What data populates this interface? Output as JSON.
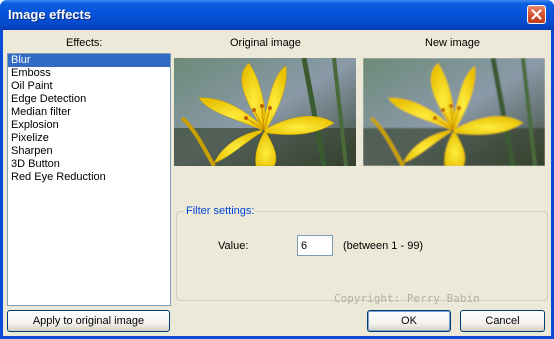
{
  "window": {
    "title": "Image effects",
    "close_icon": "close-icon"
  },
  "effects": {
    "label": "Effects:",
    "items": [
      "Blur",
      "Emboss",
      "Oil Paint",
      "Edge Detection",
      "Median filter",
      "Explosion",
      "Pixelize",
      "Sharpen",
      "3D Button",
      "Red Eye Reduction"
    ],
    "selected_index": 0
  },
  "images": {
    "original_label": "Original image",
    "new_label": "New image"
  },
  "filter": {
    "group_title": "Filter settings:",
    "value_label": "Value:",
    "value": "6",
    "range_hint": "(between 1 - 99)"
  },
  "watermark": "Copyright: Perry Babin",
  "buttons": {
    "apply": "Apply to original image",
    "ok": "OK",
    "cancel": "Cancel"
  },
  "colors": {
    "title_bar": "#0655dc",
    "selection": "#316ac5",
    "dialog_bg": "#ece9d8",
    "group_title": "#0046d5",
    "close_button": "#d7512f"
  }
}
